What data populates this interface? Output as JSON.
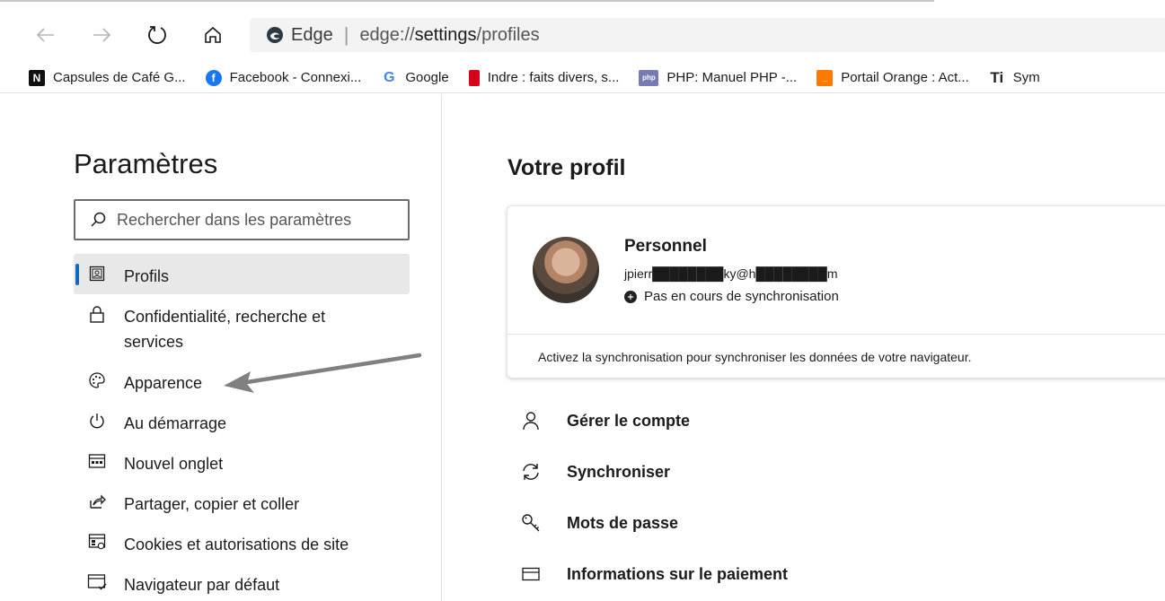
{
  "browser": {
    "site_name": "Edge",
    "url_prefix": "edge://",
    "url_settings": "settings",
    "url_path": "/profiles"
  },
  "favorites": [
    {
      "label": "Capsules de Café G...",
      "icon": "nespresso-icon",
      "color": "#111111"
    },
    {
      "label": "Facebook - Connexi...",
      "icon": "facebook-icon",
      "color": "#1877f2"
    },
    {
      "label": "Google",
      "icon": "google-icon",
      "color": "#4285f4"
    },
    {
      "label": "Indre : faits divers, s...",
      "icon": "news-icon",
      "color": "#d6001c"
    },
    {
      "label": "PHP: Manuel PHP -...",
      "icon": "php-icon",
      "color": "#777bb3"
    },
    {
      "label": "Portail Orange : Act...",
      "icon": "orange-icon",
      "color": "#ff7900"
    },
    {
      "label": "Sym",
      "icon": "ti-icon",
      "color": "#222222"
    }
  ],
  "settings": {
    "title": "Paramètres",
    "search_placeholder": "Rechercher dans les paramètres",
    "menu": [
      {
        "label": "Profils",
        "icon": "profile-icon",
        "active": true
      },
      {
        "label": "Confidentialité, recherche et services",
        "icon": "lock-icon"
      },
      {
        "label": "Apparence",
        "icon": "palette-icon"
      },
      {
        "label": "Au démarrage",
        "icon": "power-icon"
      },
      {
        "label": "Nouvel onglet",
        "icon": "new-tab-icon"
      },
      {
        "label": "Partager, copier et coller",
        "icon": "share-icon"
      },
      {
        "label": "Cookies et autorisations de site",
        "icon": "cookies-icon"
      },
      {
        "label": "Navigateur par défaut",
        "icon": "default-browser-icon"
      }
    ]
  },
  "profile": {
    "section_title": "Votre profil",
    "name": "Personnel",
    "email": "jpierr████████ky@h████████m",
    "sync_status": "Pas en cours de synchronisation",
    "sync_prompt": "Activez la synchronisation pour synchroniser les données de votre navigateur.",
    "actions": [
      {
        "label": "Gérer le compte",
        "icon": "person-icon"
      },
      {
        "label": "Synchroniser",
        "icon": "sync-icon"
      },
      {
        "label": "Mots de passe",
        "icon": "key-icon"
      },
      {
        "label": "Informations sur le paiement",
        "icon": "card-icon"
      }
    ]
  },
  "colors": {
    "accent": "#0f6cbd",
    "annotation_arrow": "#808080"
  }
}
